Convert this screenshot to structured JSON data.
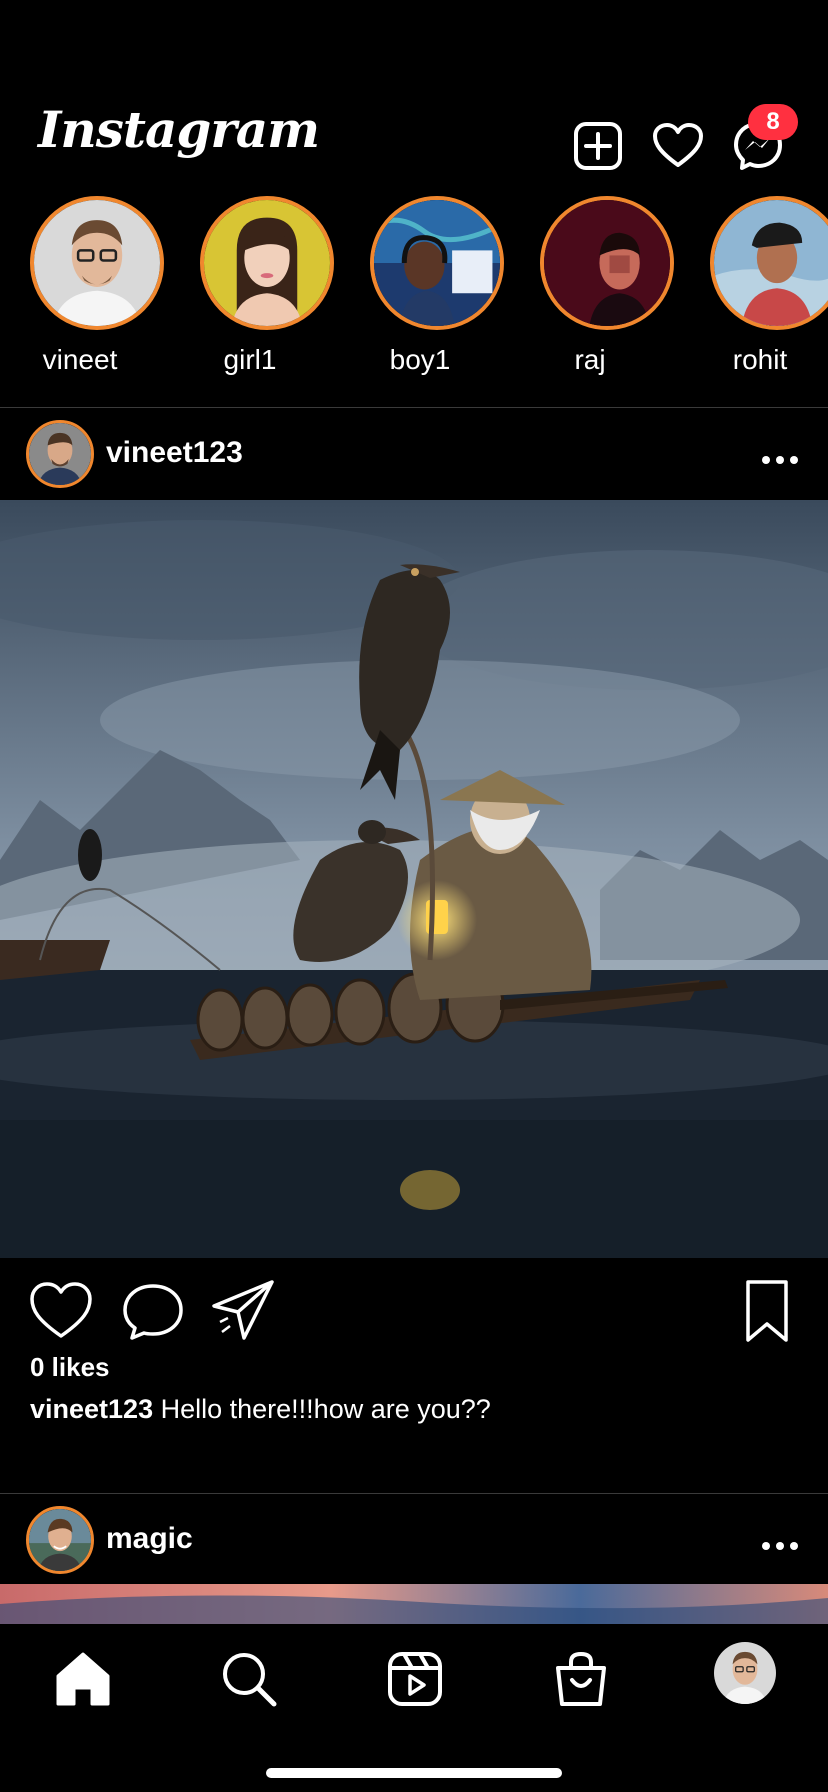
{
  "header": {
    "logo_text": "Instagram",
    "icons": [
      "add-post-icon",
      "heart-icon",
      "messenger-icon"
    ],
    "messenger_badge": "8"
  },
  "stories": [
    {
      "label": "vineet"
    },
    {
      "label": "girl1"
    },
    {
      "label": "boy1"
    },
    {
      "label": "raj"
    },
    {
      "label": "rohit"
    }
  ],
  "posts": [
    {
      "username": "vineet123",
      "likes": "0 likes",
      "caption_user": "vineet123",
      "caption_text": "Hello there!!!how are you??"
    },
    {
      "username": "magic"
    }
  ],
  "tabbar": {
    "tabs": [
      "home-icon",
      "search-icon",
      "reels-icon",
      "shop-icon",
      "profile-avatar"
    ]
  },
  "colors": {
    "story_ring": "#f0872e",
    "badge": "#ff3040",
    "background": "#000000"
  }
}
